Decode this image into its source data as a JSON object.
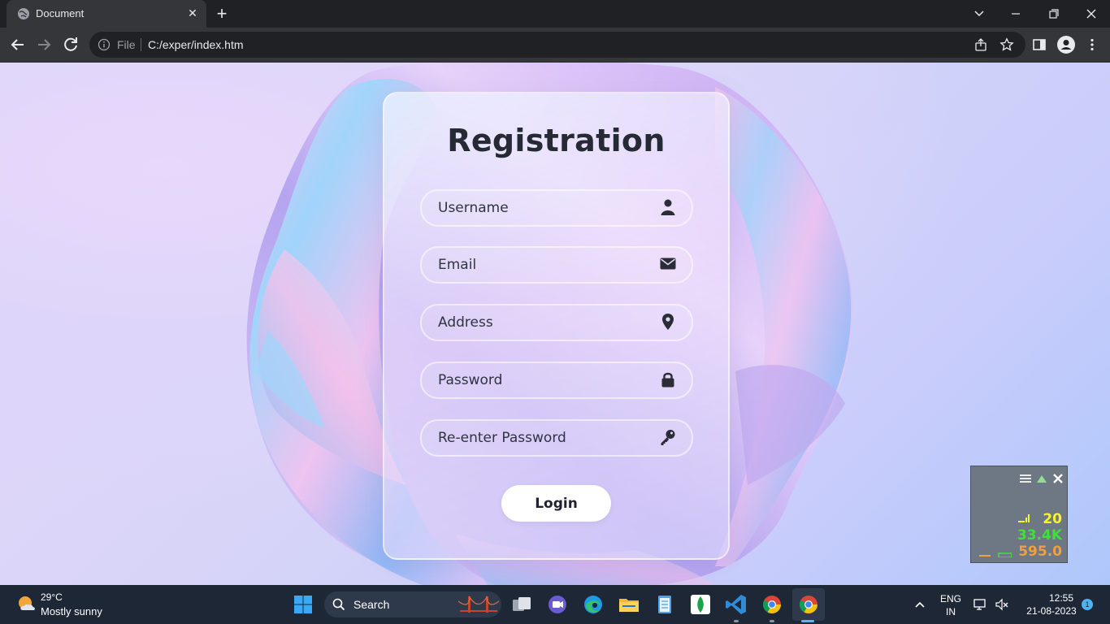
{
  "browser": {
    "tab_title": "Document",
    "file_label": "File",
    "url": "C:/exper/index.htm",
    "icons": [
      "globe-icon",
      "close-icon",
      "plus-icon",
      "chevron-down-icon",
      "minimize-icon",
      "restore-icon",
      "window-close-icon",
      "back-arrow-icon",
      "forward-arrow-icon",
      "reload-icon",
      "info-icon",
      "share-icon",
      "star-icon",
      "side-panel-icon",
      "profile-icon",
      "kebab-menu-icon"
    ]
  },
  "form": {
    "title": "Registration",
    "fields": [
      {
        "placeholder": "Username",
        "icon": "user-icon"
      },
      {
        "placeholder": "Email",
        "icon": "envelope-icon"
      },
      {
        "placeholder": "Address",
        "icon": "location-pin-icon"
      },
      {
        "placeholder": "Password",
        "icon": "lock-icon"
      },
      {
        "placeholder": "Re-enter Password",
        "icon": "key-icon"
      }
    ],
    "submit_label": "Login"
  },
  "net_monitor": {
    "value_1": "20",
    "value_2": "33.4K",
    "value_3": "595.0",
    "colors": {
      "value_1": "#f5f52a",
      "value_2": "#3fe03a",
      "value_3": "#f0a040"
    }
  },
  "taskbar": {
    "weather": {
      "temp": "29°C",
      "condition": "Mostly sunny"
    },
    "search_label": "Search",
    "tray": {
      "lang_1": "ENG",
      "lang_2": "IN",
      "time": "12:55",
      "date": "21-08-2023",
      "notifications": "1"
    }
  }
}
